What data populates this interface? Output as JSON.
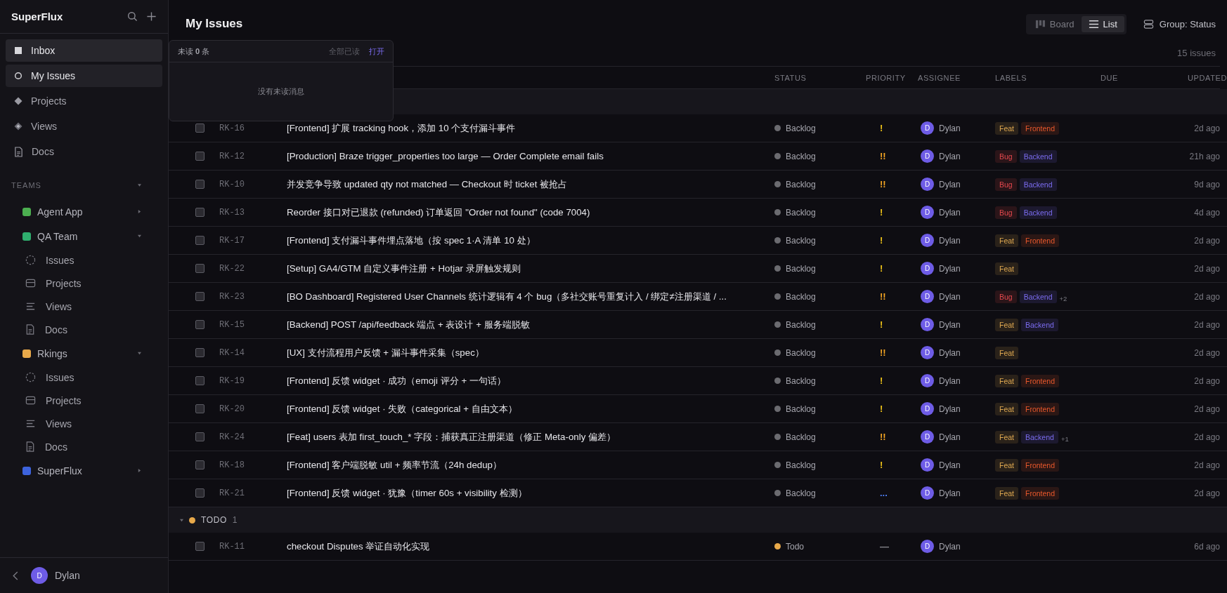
{
  "sidebar": {
    "workspace": "SuperFlux",
    "nav": [
      {
        "label": "Inbox",
        "kind": "inbox",
        "selected": true
      },
      {
        "label": "My Issues",
        "kind": "issues",
        "selected": true
      },
      {
        "label": "Projects",
        "kind": "projects",
        "selected": false
      },
      {
        "label": "Views",
        "kind": "views",
        "selected": false
      },
      {
        "label": "Docs",
        "kind": "docs",
        "selected": false
      }
    ],
    "teams_heading": "TEAMS",
    "teams": [
      {
        "name": "Agent App",
        "color": "#4caf50",
        "expanded": false
      },
      {
        "name": "QA Team",
        "color": "#2fae6e",
        "expanded": true,
        "children": [
          {
            "label": "Issues",
            "kind": "issues"
          },
          {
            "label": "Projects",
            "kind": "projects"
          },
          {
            "label": "Views",
            "kind": "views"
          },
          {
            "label": "Docs",
            "kind": "docs"
          }
        ]
      },
      {
        "name": "Rkings",
        "color": "#e8a94a",
        "expanded": true,
        "children": [
          {
            "label": "Issues",
            "kind": "issues"
          },
          {
            "label": "Projects",
            "kind": "projects"
          },
          {
            "label": "Views",
            "kind": "views"
          },
          {
            "label": "Docs",
            "kind": "docs"
          }
        ]
      },
      {
        "name": "SuperFlux",
        "color": "#3d63dd",
        "expanded": false
      }
    ],
    "user": {
      "initial": "D",
      "name": "Dylan"
    }
  },
  "header": {
    "title": "My Issues",
    "views": [
      {
        "label": "Board",
        "kind": "board",
        "selected": false
      },
      {
        "label": "List",
        "kind": "list",
        "selected": true
      }
    ],
    "group_by": "Group: Status",
    "count": "15 issues"
  },
  "popover": {
    "title": "未读 **0** 条",
    "mark_all": "全部已读",
    "open": "打开",
    "empty": "没有未读消息"
  },
  "columns": [
    "STATUS",
    "PRIORITY",
    "ASSIGNEE",
    "LABELS",
    "DUE",
    "UPDATED"
  ],
  "groups": [
    {
      "rows": [
        {
          "checked": false,
          "id": "RK-16",
          "title": "[Frontend] 扩展 tracking hook，添加 10 个支付漏斗事件",
          "status": {
            "label": "Backlog",
            "color": "#6b6b70"
          },
          "priority": {
            "kind": "medium",
            "mark": "!"
          },
          "assignee": "Dylan",
          "initial": "D",
          "labels": [
            {
              "text": "Feat",
              "color": "#e0a951"
            },
            {
              "text": "Frontend",
              "color": "#e8582c"
            }
          ],
          "updated": "2d ago"
        },
        {
          "checked": false,
          "id": "RK-12",
          "title": "[Production] Braze trigger_properties too large — Order Complete email fails",
          "status": {
            "label": "Backlog",
            "color": "#6b6b70"
          },
          "priority": {
            "kind": "high",
            "mark": "!!"
          },
          "assignee": "Dylan",
          "initial": "D",
          "labels": [
            {
              "text": "Bug",
              "color": "#e5484d"
            },
            {
              "text": "Backend",
              "color": "#7b6cf0"
            }
          ],
          "updated": "21h ago"
        },
        {
          "checked": false,
          "id": "RK-10",
          "title": "并发竞争导致 updated qty not matched — Checkout 时 ticket 被抢占",
          "status": {
            "label": "Backlog",
            "color": "#6b6b70"
          },
          "priority": {
            "kind": "high",
            "mark": "!!"
          },
          "assignee": "Dylan",
          "initial": "D",
          "labels": [
            {
              "text": "Bug",
              "color": "#e5484d"
            },
            {
              "text": "Backend",
              "color": "#7b6cf0"
            }
          ],
          "updated": "9d ago"
        },
        {
          "checked": false,
          "id": "RK-13",
          "title": "Reorder 接口对已退款 (refunded) 订单返回 \"Order not found\" (code 7004)",
          "status": {
            "label": "Backlog",
            "color": "#6b6b70"
          },
          "priority": {
            "kind": "medium",
            "mark": "!"
          },
          "assignee": "Dylan",
          "initial": "D",
          "labels": [
            {
              "text": "Bug",
              "color": "#e5484d"
            },
            {
              "text": "Backend",
              "color": "#7b6cf0"
            }
          ],
          "updated": "4d ago"
        },
        {
          "checked": false,
          "id": "RK-17",
          "title": "[Frontend] 支付漏斗事件埋点落地（按 spec 1·A 清单 10 处）",
          "status": {
            "label": "Backlog",
            "color": "#6b6b70"
          },
          "priority": {
            "kind": "medium",
            "mark": "!"
          },
          "assignee": "Dylan",
          "initial": "D",
          "labels": [
            {
              "text": "Feat",
              "color": "#e0a951"
            },
            {
              "text": "Frontend",
              "color": "#e8582c"
            }
          ],
          "updated": "2d ago"
        },
        {
          "checked": false,
          "id": "RK-22",
          "title": "[Setup] GA4/GTM 自定义事件注册 + Hotjar 录屏触发规则",
          "status": {
            "label": "Backlog",
            "color": "#6b6b70"
          },
          "priority": {
            "kind": "medium",
            "mark": "!"
          },
          "assignee": "Dylan",
          "initial": "D",
          "labels": [
            {
              "text": "Feat",
              "color": "#e0a951"
            }
          ],
          "updated": "2d ago"
        },
        {
          "checked": false,
          "id": "RK-23",
          "title": "[BO Dashboard] Registered User Channels 统计逻辑有 4 个 bug（多社交账号重复计入 / 绑定≠注册渠道 / ...",
          "status": {
            "label": "Backlog",
            "color": "#6b6b70"
          },
          "priority": {
            "kind": "high",
            "mark": "!!"
          },
          "assignee": "Dylan",
          "initial": "D",
          "labels": [
            {
              "text": "Bug",
              "color": "#e5484d"
            },
            {
              "text": "Backend",
              "color": "#7b6cf0"
            }
          ],
          "more": "+2",
          "updated": "2d ago"
        },
        {
          "checked": false,
          "id": "RK-15",
          "title": "[Backend] POST /api/feedback 端点 + 表设计 + 服务端脱敏",
          "status": {
            "label": "Backlog",
            "color": "#6b6b70"
          },
          "priority": {
            "kind": "medium",
            "mark": "!"
          },
          "assignee": "Dylan",
          "initial": "D",
          "labels": [
            {
              "text": "Feat",
              "color": "#e0a951"
            },
            {
              "text": "Backend",
              "color": "#7b6cf0"
            }
          ],
          "updated": "2d ago"
        },
        {
          "checked": false,
          "id": "RK-14",
          "title": "[UX] 支付流程用户反馈 + 漏斗事件采集（spec）",
          "status": {
            "label": "Backlog",
            "color": "#6b6b70"
          },
          "priority": {
            "kind": "high",
            "mark": "!!"
          },
          "assignee": "Dylan",
          "initial": "D",
          "labels": [
            {
              "text": "Feat",
              "color": "#e0a951"
            }
          ],
          "updated": "2d ago"
        },
        {
          "checked": false,
          "id": "RK-19",
          "title": "[Frontend] 反馈 widget · 成功（emoji 评分 + 一句话）",
          "status": {
            "label": "Backlog",
            "color": "#6b6b70"
          },
          "priority": {
            "kind": "medium",
            "mark": "!"
          },
          "assignee": "Dylan",
          "initial": "D",
          "labels": [
            {
              "text": "Feat",
              "color": "#e0a951"
            },
            {
              "text": "Frontend",
              "color": "#e8582c"
            }
          ],
          "updated": "2d ago"
        },
        {
          "checked": false,
          "id": "RK-20",
          "title": "[Frontend] 反馈 widget · 失败（categorical + 自由文本）",
          "status": {
            "label": "Backlog",
            "color": "#6b6b70"
          },
          "priority": {
            "kind": "medium",
            "mark": "!"
          },
          "assignee": "Dylan",
          "initial": "D",
          "labels": [
            {
              "text": "Feat",
              "color": "#e0a951"
            },
            {
              "text": "Frontend",
              "color": "#e8582c"
            }
          ],
          "updated": "2d ago"
        },
        {
          "checked": false,
          "id": "RK-24",
          "title": "[Feat] users 表加 first_touch_* 字段：捕获真正注册渠道（修正 Meta-only 偏差）",
          "status": {
            "label": "Backlog",
            "color": "#6b6b70"
          },
          "priority": {
            "kind": "high",
            "mark": "!!"
          },
          "assignee": "Dylan",
          "initial": "D",
          "labels": [
            {
              "text": "Feat",
              "color": "#e0a951"
            },
            {
              "text": "Backend",
              "color": "#7b6cf0"
            }
          ],
          "more": "+1",
          "updated": "2d ago"
        },
        {
          "checked": false,
          "id": "RK-18",
          "title": "[Frontend] 客户端脱敏 util + 频率节流（24h dedup）",
          "status": {
            "label": "Backlog",
            "color": "#6b6b70"
          },
          "priority": {
            "kind": "medium",
            "mark": "!"
          },
          "assignee": "Dylan",
          "initial": "D",
          "labels": [
            {
              "text": "Feat",
              "color": "#e0a951"
            },
            {
              "text": "Frontend",
              "color": "#e8582c"
            }
          ],
          "updated": "2d ago"
        },
        {
          "checked": false,
          "id": "RK-21",
          "title": "[Frontend] 反馈 widget · 犹豫（timer 60s + visibility 检测）",
          "status": {
            "label": "Backlog",
            "color": "#6b6b70"
          },
          "priority": {
            "kind": "low",
            "mark": "..."
          },
          "assignee": "Dylan",
          "initial": "D",
          "labels": [
            {
              "text": "Feat",
              "color": "#e0a951"
            },
            {
              "text": "Frontend",
              "color": "#e8582c"
            }
          ],
          "updated": "2d ago"
        }
      ]
    },
    {
      "name": "TODO",
      "count": "1",
      "color": "#e8a94a",
      "expanded": true,
      "rows": [
        {
          "checked": false,
          "id": "RK-11",
          "title": "checkout Disputes 举证自动化实现",
          "status": {
            "label": "Todo",
            "color": "#e8a94a"
          },
          "priority": {
            "kind": "none",
            "mark": "—"
          },
          "assignee": "Dylan",
          "initial": "D",
          "labels": [],
          "updated": "6d ago"
        }
      ]
    }
  ]
}
